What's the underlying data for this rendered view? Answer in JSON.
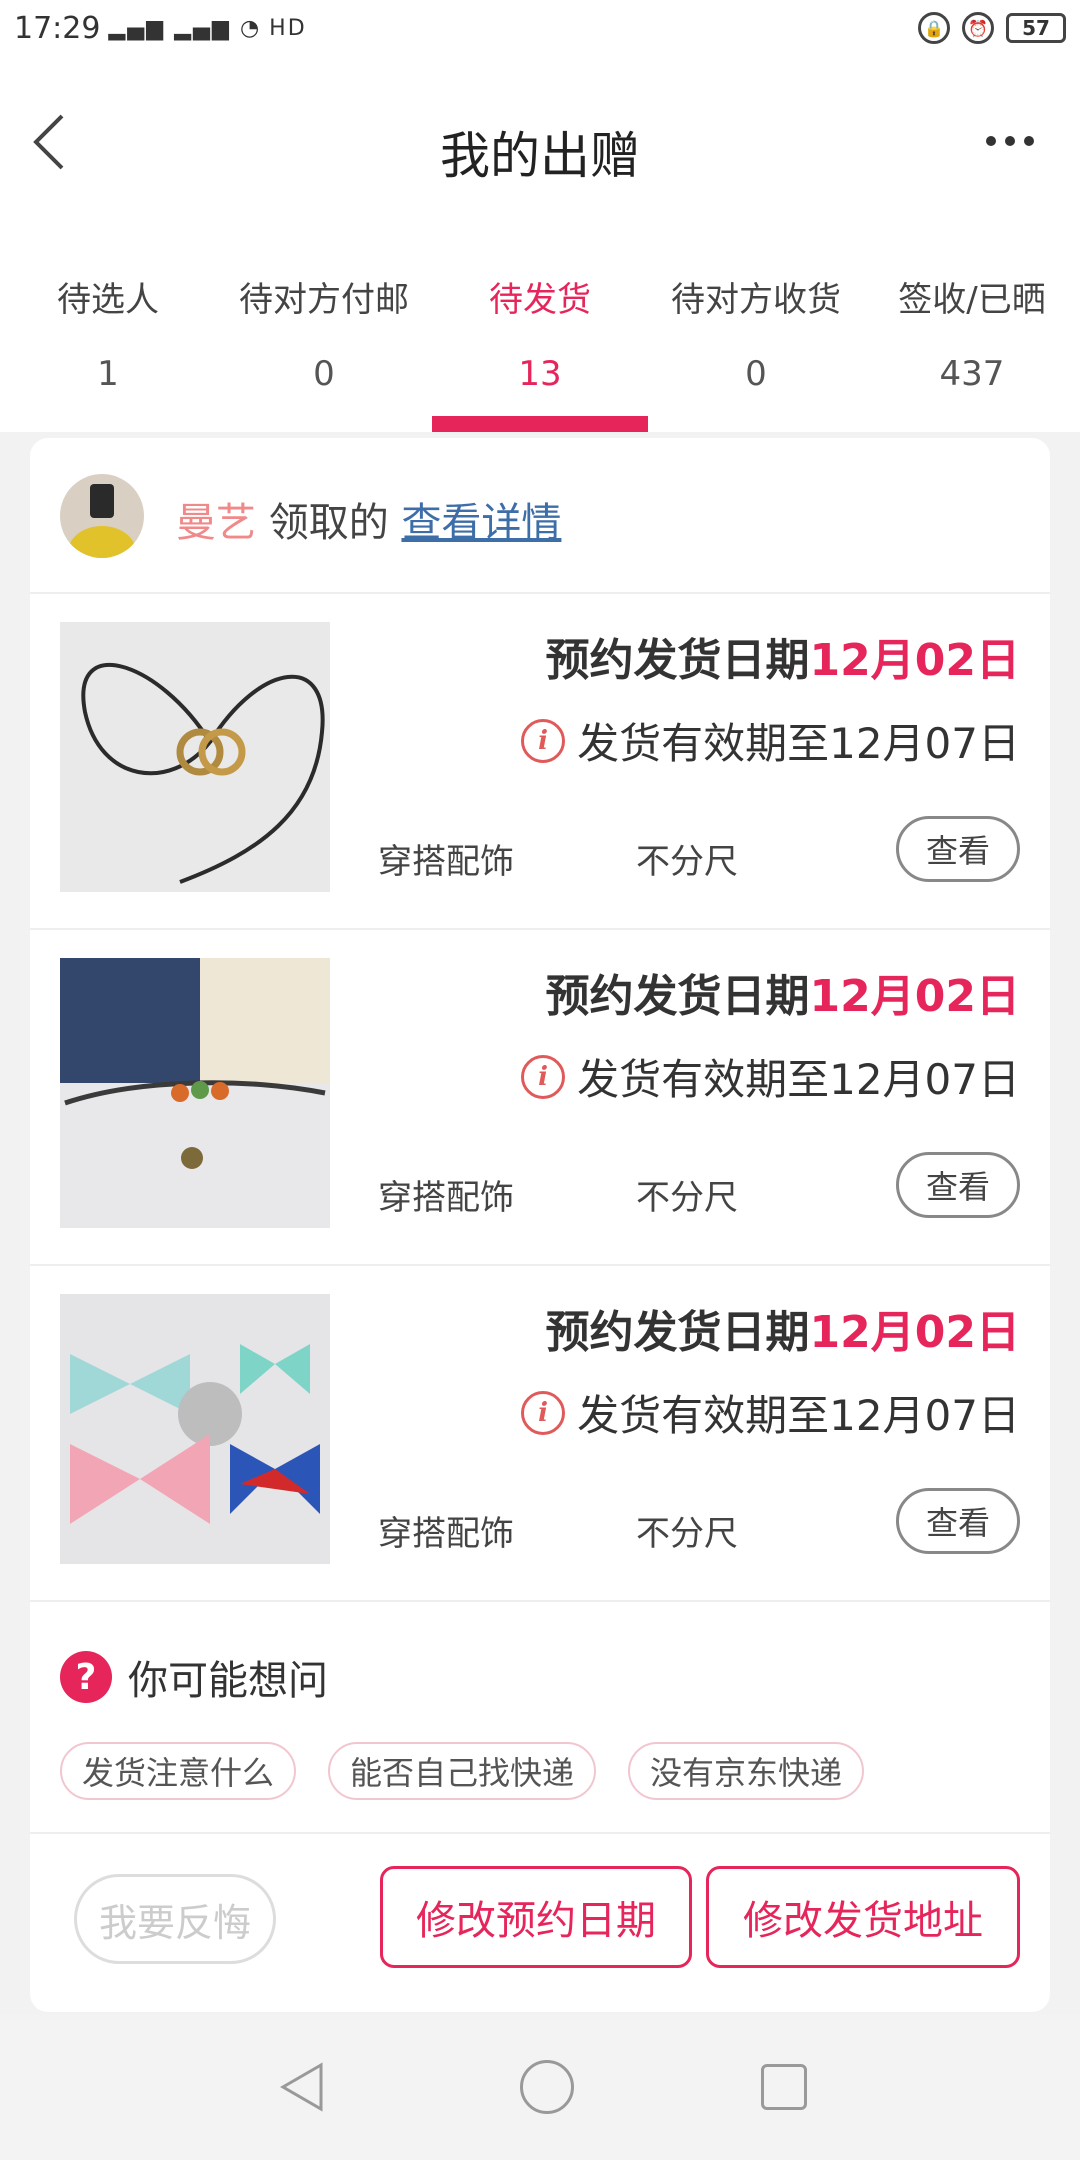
{
  "status_bar": {
    "time": "17:29",
    "signal_label": "4G 4G",
    "hd_label": "HD",
    "battery": "57"
  },
  "header": {
    "title": "我的出赠"
  },
  "tabs": [
    {
      "label": "待选人",
      "count": "1"
    },
    {
      "label": "待对方付邮",
      "count": "0"
    },
    {
      "label": "待发货",
      "count": "13"
    },
    {
      "label": "待对方收货",
      "count": "0"
    },
    {
      "label": "签收/已晒",
      "count": "437"
    }
  ],
  "giver": {
    "name": "曼艺",
    "claimed_text": "领取的",
    "link": "查看详情"
  },
  "items": [
    {
      "schedule_label": "预约发货日期",
      "schedule_date": "12月02日",
      "valid_text": "发货有效期至12月07日",
      "category": "穿搭配饰",
      "size": "不分尺",
      "view_label": "查看"
    },
    {
      "schedule_label": "预约发货日期",
      "schedule_date": "12月02日",
      "valid_text": "发货有效期至12月07日",
      "category": "穿搭配饰",
      "size": "不分尺",
      "view_label": "查看"
    },
    {
      "schedule_label": "预约发货日期",
      "schedule_date": "12月02日",
      "valid_text": "发货有效期至12月07日",
      "category": "穿搭配饰",
      "size": "不分尺",
      "view_label": "查看"
    }
  ],
  "faq": {
    "title": "你可能想问",
    "chips": [
      "发货注意什么",
      "能否自己找快递",
      "没有京东快递"
    ]
  },
  "actions": {
    "regret": "我要反悔",
    "change_date": "修改预约日期",
    "change_address": "修改发货地址"
  },
  "colors": {
    "accent": "#e6255a",
    "link": "#3d6ea8",
    "name": "#f08a8a"
  }
}
